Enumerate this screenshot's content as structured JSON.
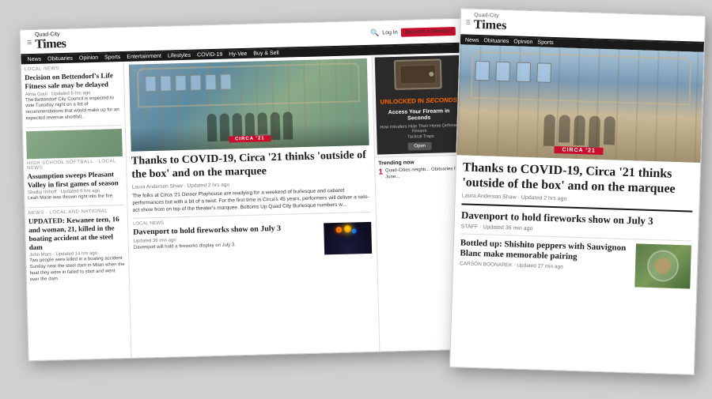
{
  "page": {
    "bg_color": "#d0d0d0"
  },
  "main_newspaper": {
    "logo": "Times",
    "logo_eyebrow": "Quad-City",
    "nav_items": [
      "News",
      "Obituaries",
      "Opinion",
      "Sports",
      "Entertainment",
      "Lifestyles",
      "COVID-19",
      "Hy-Vee",
      "Buy & Sell"
    ],
    "header_actions": {
      "login": "Log In",
      "member": "Become a Member"
    },
    "sidebar": {
      "section1_label": "LOCAL NEWS",
      "headline1": "Decision on Bettendorf's Life Fitness sale may be delayed",
      "byline1": "Alma Gaul · Updated 6 hrs ago",
      "body1": "The Bettendorf City Council is expected to vote Tuesday night on a list of recommendations that would make up for an expected revenue shortfall...",
      "section2_label": "HIGH SCHOOL SOFTBALL · LOCAL NEWS",
      "headline2": "Assumption sweeps Pleasant Valley in first games of season",
      "byline2": "Shelby Imhoff · Updated 6 hrs ago",
      "body2": "Leah Marie was thrown right into the fire.",
      "section3_label": "NEWS · LOCAL AND NATIONAL",
      "headline3": "UPDATED: Kewanee teen, 16 and woman, 21, killed in the boating accident at the steel dam",
      "byline3": "John Mars · Updated 14 hrs ago",
      "body3": "Two people were killed in a boating accident Sunday near the steel dam in Milan when the boat they were in failed to start and went over the dam."
    },
    "main_article": {
      "headline": "Thanks to COVID-19, Circa '21 thinks 'outside of the box' and on the marquee",
      "byline": "Laura Anderson Shaw · Updated 2 hrs ago",
      "body": "The folks at Circa '21 Dinner Playhouse are readying for a weekend of burlesque and cabaret performances but with a bit of a twist: For the first time in Circa's 45 years, performers will deliver a solo-act show from on top of the theater's marquee. Bottoms Up Quad City Burlesque numbers w..."
    },
    "secondary_article": {
      "section_label": "LOCAL NEWS",
      "headline": "Davenport to hold fireworks show on July 3",
      "byline": "Updated 36 min ago",
      "body": "Davenport will hold a fireworks display on July 3."
    },
    "ad": {
      "unlocked_label": "Unlocked in",
      "unlocked_seconds": "SECONDS",
      "headline": "Access Your Firearm in Seconds",
      "sub1": "How Intruders Hide Their Home Defense Firearm",
      "sub2": "· Tactical Traps",
      "open_btn": "Open"
    },
    "trending": {
      "label": "Trending now",
      "items": [
        "Quad-Cities neighb... Obituaries for June..."
      ]
    }
  },
  "secondary_newspaper": {
    "logo": "Times",
    "logo_eyebrow": "Quad-City",
    "nav_items": [
      "News",
      "Obituaries",
      "Opinion",
      "Sports"
    ],
    "main_article": {
      "headline": "Thanks to COVID-19, Circa '21 thinks 'outside of the box' and on the marquee",
      "byline": "Laura Anderson Shaw · Updated 2 hrs ago"
    },
    "secondary_article": {
      "headline": "Davenport to hold fireworks show on July 3",
      "staff": "STAFF · Updated 36 min ago"
    },
    "bottom_article": {
      "headline": "Bottled up: Shishito peppers with Sauvignon Blanc make memorable pairing",
      "byline": "CARSON BOONAREK · Updated 27 min ago"
    }
  }
}
